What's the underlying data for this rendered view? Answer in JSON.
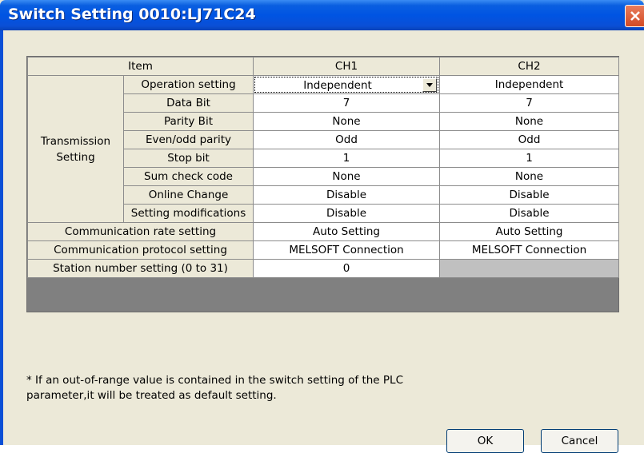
{
  "window": {
    "title": "Switch Setting 0010:LJ71C24"
  },
  "table": {
    "headers": {
      "item": "Item",
      "ch1": "CH1",
      "ch2": "CH2"
    },
    "group_label_line1": "Transmission",
    "group_label_line2": "Setting",
    "rows": [
      {
        "label": "Operation setting",
        "ch1": "Independent",
        "ch2": "Independent"
      },
      {
        "label": "Data Bit",
        "ch1": "7",
        "ch2": "7"
      },
      {
        "label": "Parity Bit",
        "ch1": "None",
        "ch2": "None"
      },
      {
        "label": "Even/odd parity",
        "ch1": "Odd",
        "ch2": "Odd"
      },
      {
        "label": "Stop bit",
        "ch1": "1",
        "ch2": "1"
      },
      {
        "label": "Sum check code",
        "ch1": "None",
        "ch2": "None"
      },
      {
        "label": "Online Change",
        "ch1": "Disable",
        "ch2": "Disable"
      },
      {
        "label": "Setting modifications",
        "ch1": "Disable",
        "ch2": "Disable"
      }
    ],
    "wide_rows": [
      {
        "label": "Communication rate setting",
        "ch1": "Auto Setting",
        "ch2": "Auto Setting"
      },
      {
        "label": "Communication protocol setting",
        "ch1": "MELSOFT Connection",
        "ch2": "MELSOFT Connection"
      },
      {
        "label": "Station number setting (0 to 31)",
        "ch1": "0",
        "ch2": ""
      }
    ]
  },
  "note": {
    "line1": "* If an out-of-range value is contained in the switch setting of the PLC",
    "line2": "parameter,it will be treated as default setting."
  },
  "buttons": {
    "ok": "OK",
    "cancel": "Cancel"
  }
}
